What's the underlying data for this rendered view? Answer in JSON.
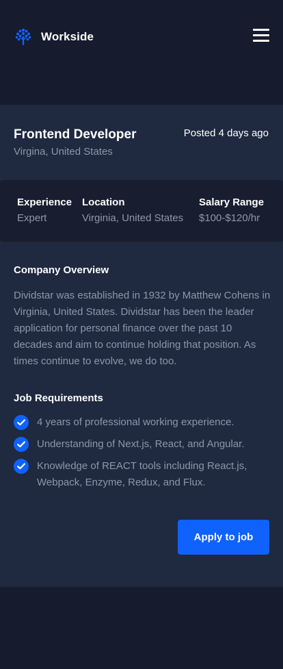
{
  "header": {
    "brand_name": "Workside",
    "logo_icon": "tree-logo-icon",
    "menu_icon": "hamburger-menu-icon"
  },
  "job": {
    "title": "Frontend Developer",
    "location": "Virgina, United States",
    "posted": "Posted 4 days ago"
  },
  "details": {
    "experience": {
      "label": "Experience",
      "value": "Expert"
    },
    "location": {
      "label": "Location",
      "value": "Virginia, United States"
    },
    "salary": {
      "label": "Salary Range",
      "value": "$100-$120/hr"
    }
  },
  "company": {
    "heading": "Company Overview",
    "text": "Dividstar was established in 1932 by Matthew Cohens in Virginia, United States. Dividstar has been the leader application for personal finance over the past 10 decades and aim to continue holding that position. As times continue to evolve, we do too."
  },
  "requirements": {
    "heading": "Job Requirements",
    "items": [
      "4 years of professional working experience.",
      "Understanding of Next.js, React, and Angular.",
      "Knowledge of REACT tools including React.js, Webpack, Enzyme, Redux, and Flux."
    ]
  },
  "actions": {
    "apply_label": "Apply to job"
  },
  "colors": {
    "accent": "#0f62fe",
    "page_bg": "#161b2d",
    "card_bg": "#1f2940",
    "muted_text": "#8e97a8"
  }
}
